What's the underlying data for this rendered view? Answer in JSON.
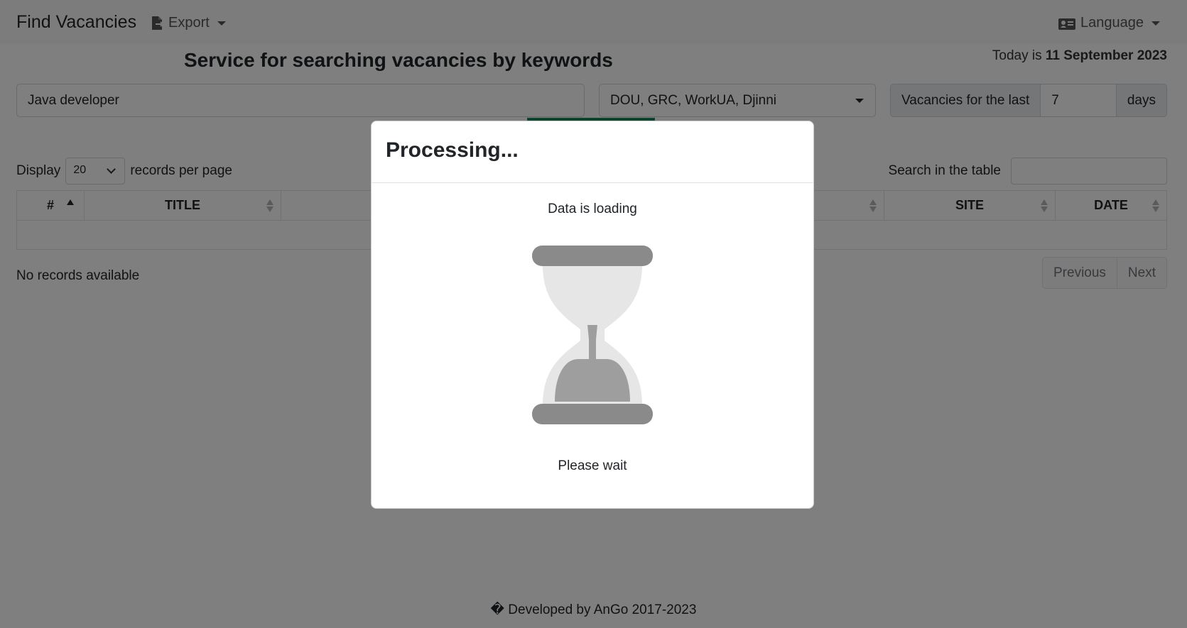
{
  "navbar": {
    "brand": "Find Vacancies",
    "export_label": "Export",
    "language_label": "Language"
  },
  "header": {
    "title": "Service for searching vacancies by keywords",
    "today_prefix": "Today is",
    "today_date": "11 September 2023"
  },
  "search": {
    "keywords_value": "Java developer",
    "sites_value": "DOU, GRC, WorkUA, Djinni",
    "days_prefix": "Vacancies for the last",
    "days_value": "7",
    "days_suffix": "days"
  },
  "table_controls": {
    "display_label": "Display",
    "page_length": "20",
    "per_page_label": "records per page",
    "search_label": "Search in the table"
  },
  "table": {
    "columns": [
      "#",
      "TITLE",
      "",
      "SITE",
      "DATE"
    ],
    "info": "No records available"
  },
  "pagination": {
    "previous": "Previous",
    "next": "Next"
  },
  "footer": {
    "text": "� Developed by AnGo 2017-2023"
  },
  "modal": {
    "title": "Processing...",
    "loading_text": "Data is loading",
    "wait_text": "Please wait"
  },
  "colors": {
    "accent": "#198754",
    "backdrop": "#000000"
  },
  "icons": [
    "file-export-icon",
    "id-card-icon",
    "hourglass-icon"
  ]
}
